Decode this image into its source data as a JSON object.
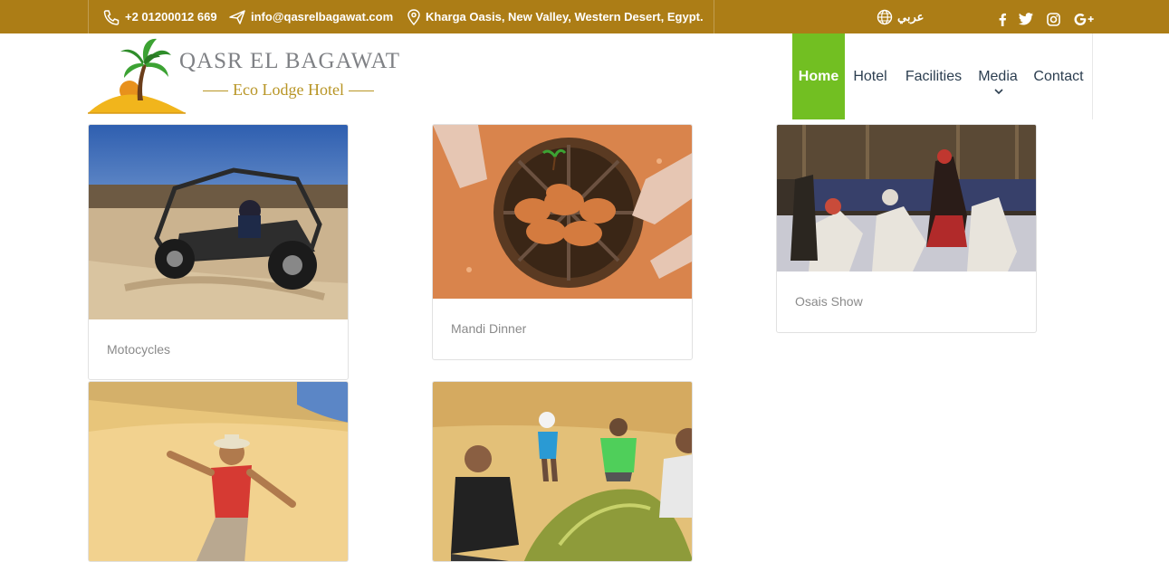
{
  "topbar": {
    "phone": "+2 01200012 669",
    "email": "info@qasrelbagawat.com",
    "address": "Kharga Oasis, New Valley, Western Desert, Egypt.",
    "language": "عربي",
    "social_icons": [
      "facebook-icon",
      "twitter-icon",
      "instagram-icon",
      "google-plus-icon"
    ]
  },
  "logo": {
    "title": "QASR EL BAGAWAT",
    "subtitle": "Eco Lodge Hotel"
  },
  "nav": {
    "items": [
      {
        "label": "Home",
        "active": true
      },
      {
        "label": "Hotel",
        "active": false
      },
      {
        "label": "Facilities",
        "active": false
      },
      {
        "label": "Media",
        "active": false,
        "has_dropdown": true
      },
      {
        "label": "Contact",
        "active": false
      }
    ]
  },
  "gallery": {
    "cards": [
      {
        "caption": "Motocycles"
      },
      {
        "caption": "Mandi Dinner"
      },
      {
        "caption": "Osais Show"
      },
      {
        "caption": ""
      },
      {
        "caption": ""
      }
    ]
  },
  "colors": {
    "topbar": "#ac7d16",
    "nav_active": "#72bf22",
    "nav_text": "#2c3e50",
    "logo_gold": "#b89525"
  }
}
